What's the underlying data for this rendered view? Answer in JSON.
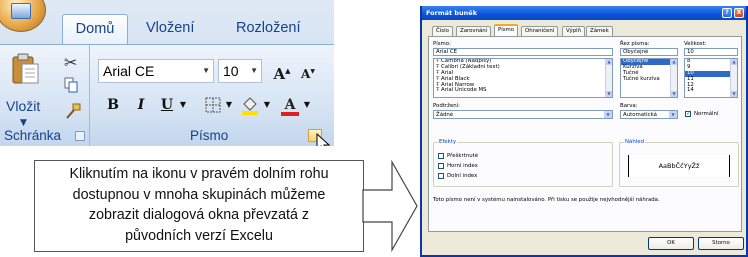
{
  "ribbon": {
    "tabs": [
      "Domů",
      "Vložení",
      "Rozložení stránky"
    ],
    "active_tab": "Domů",
    "clipboard_group": {
      "label": "Schránka",
      "paste_label": "Vložit"
    },
    "font_group": {
      "label": "Písmo",
      "font_name": "Arial CE",
      "font_size": "10",
      "grow_font": "A",
      "shrink_font": "A",
      "bold": "B",
      "italic": "I",
      "underline": "U",
      "font_color": "A",
      "font_color_hex": "#e02020",
      "fill_color_hex": "#ffe000"
    }
  },
  "callout": {
    "lines": [
      "Kliknutím na ikonu v pravém dolním rohu",
      "dostupnou v mnoha skupinách můžeme",
      "zobrazit dialogová okna převzatá z",
      "původních verzí Excelu"
    ]
  },
  "dialog": {
    "title": "Formát buněk",
    "help": "?",
    "close": "X",
    "tabs": [
      "Číslo",
      "Zarovnání",
      "Písmo",
      "Ohraničení",
      "Výplň",
      "Zámek"
    ],
    "active_tab": "Písmo",
    "font_label": "Písmo:",
    "font_value": "Arial CE",
    "font_list": [
      "Cambria (Nadpisy)",
      "Calibri (Základní text)",
      "Arial",
      "Arial Black",
      "Arial Narrow",
      "Arial Unicode MS"
    ],
    "style_label": "Řez písma:",
    "style_value": "Obyčejné",
    "style_list": [
      "Obyčejné",
      "Kurzíva",
      "Tučné",
      "Tučné kurzíva"
    ],
    "size_label": "Velikost:",
    "size_value": "10",
    "size_list": [
      "8",
      "9",
      "10",
      "11",
      "12",
      "14"
    ],
    "size_selected": "10",
    "underline_label": "Podtržení:",
    "underline_value": "Žádné",
    "color_label": "Barva:",
    "color_value": "Automatická",
    "normal_label": "Normální",
    "effects_label": "Efekty",
    "effects": [
      "Přeškrtnuté",
      "Horní index",
      "Dolní index"
    ],
    "preview_label": "Náhled",
    "preview_text": "AaBbČčYyŽž",
    "note": "Toto písmo není v systému nainstalováno. Při tisku se použije nejvhodnější náhrada.",
    "ok": "OK",
    "cancel": "Storno"
  }
}
